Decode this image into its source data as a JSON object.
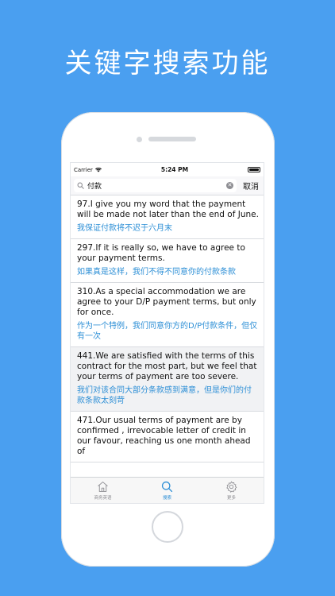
{
  "headline": "关键字搜索功能",
  "status_bar": {
    "carrier": "Carrier",
    "time": "5:24 PM"
  },
  "search": {
    "value": "付款",
    "cancel_label": "取消"
  },
  "results": [
    {
      "en": "97.I give you my word that the payment will be made not later than the end of June.",
      "zh": "我保证付款将不迟于六月末"
    },
    {
      "en": "297.If it is really so, we have to agree to your payment terms.",
      "zh": "如果真是这样，我们不得不同意你的付款条款"
    },
    {
      "en": "310.As a special accommodation we are agree to your D/P payment terms, but only for once.",
      "zh": "作为一个特例，我们同意你方的D/P付款条件，但仅有一次"
    },
    {
      "en": "441.We are satisfied with the terms of this contract for the most part, but we feel that your terms of payment are too severe.",
      "zh": "我们对该合同大部分条款感到满意，但是你们的付款条款太刻苛"
    },
    {
      "en": "471.Our usual terms of payment are by confirmed , irrevocable letter of credit in our favour, reaching us one month ahead of",
      "zh": ""
    }
  ],
  "tabbar": [
    {
      "label": "商务英语",
      "icon": "home-icon",
      "active": false
    },
    {
      "label": "搜索",
      "icon": "search-icon",
      "active": true
    },
    {
      "label": "更多",
      "icon": "gear-icon",
      "active": false
    }
  ],
  "colors": {
    "background": "#4a9ff0",
    "accent": "#2d8fd6"
  }
}
